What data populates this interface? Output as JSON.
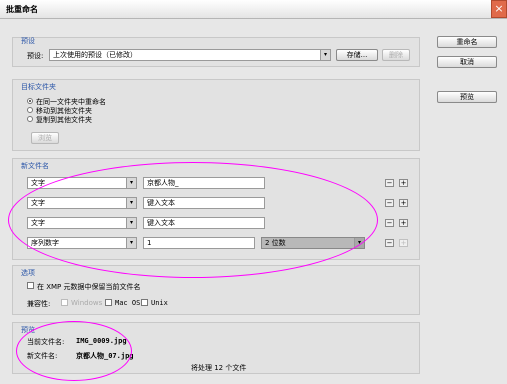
{
  "window": {
    "title": "批重命名"
  },
  "buttons": {
    "rename": "重命名",
    "cancel": "取消",
    "preview": "预览"
  },
  "presets": {
    "legend": "预设",
    "label": "预设:",
    "value": "上次使用的预设（已修改）",
    "save": "存储...",
    "delete": "删除"
  },
  "target_folder": {
    "legend": "目标文件夹",
    "options": [
      "在同一文件夹中重命名",
      "移动到其他文件夹",
      "复制到其他文件夹"
    ],
    "selected": 0,
    "browse": "浏览"
  },
  "new_filename": {
    "legend": "新文件名",
    "rows": [
      {
        "type": "文字",
        "value": "京都人物_",
        "minus": "−",
        "plus": "+"
      },
      {
        "type": "文字",
        "value": "键入文本",
        "minus": "−",
        "plus": "+"
      },
      {
        "type": "文字",
        "value": "键入文本",
        "minus": "−",
        "plus": "+"
      },
      {
        "type": "序列数字",
        "value": "1",
        "digits": "2 位数",
        "minus": "−",
        "plus": "+"
      }
    ]
  },
  "options": {
    "legend": "选项",
    "keep_xmp_label": "在 XMP 元数据中保留当前文件名",
    "compat_label": "兼容性:",
    "windows": "Windows",
    "mac": "Mac OS",
    "unix": "Unix"
  },
  "preview": {
    "legend": "预览",
    "current_label": "当前文件名:",
    "current_value": "IMG_0009.jpg",
    "new_label": "新文件名:",
    "new_value": "京都人物_07.jpg",
    "count_text": "将处理 12 个文件"
  }
}
